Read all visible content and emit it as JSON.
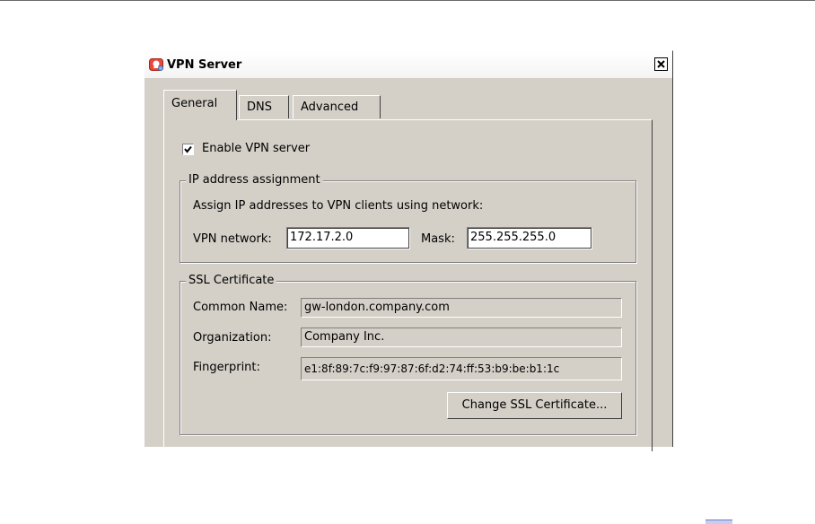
{
  "window": {
    "title": "VPN Server",
    "icon": "vpn-app-icon",
    "close_glyph": "x"
  },
  "tabs": [
    {
      "label": "General",
      "active": true
    },
    {
      "label": "DNS",
      "active": false
    },
    {
      "label": "Advanced",
      "active": false
    }
  ],
  "general": {
    "enable_label": "Enable VPN server",
    "enable_checked": true,
    "ip_group": {
      "legend": "IP address assignment",
      "description": "Assign IP addresses to VPN clients using network:",
      "network_label": "VPN network:",
      "network_value": "172.17.2.0",
      "mask_label": "Mask:",
      "mask_value": "255.255.255.0"
    },
    "ssl_group": {
      "legend": "SSL Certificate",
      "common_name_label": "Common Name:",
      "common_name_value": "gw-london.company.com",
      "organization_label": "Organization:",
      "organization_value": "Company Inc.",
      "fingerprint_label": "Fingerprint:",
      "fingerprint_value": "e1:8f:89:7c:f9:97:87:6f:d2:74:ff:53:b9:be:b1:1c",
      "change_button": "Change SSL Certificate..."
    }
  },
  "colors": {
    "dialog_bg": "#d4d0c8",
    "title_bg": "#ffffff",
    "icon_accent": "#e8483b"
  }
}
